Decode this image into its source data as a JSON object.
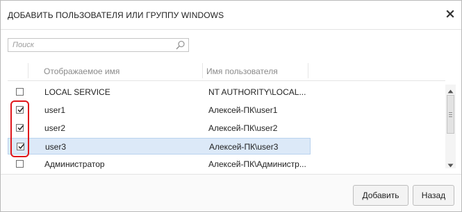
{
  "dialog": {
    "title": "ДОБАВИТЬ ПОЛЬЗОВАТЕЛЯ ИЛИ ГРУППУ WINDOWS",
    "close_icon": "close-icon"
  },
  "search": {
    "placeholder": "Поиск",
    "value": "",
    "icon": "search-icon"
  },
  "table": {
    "columns": [
      "Отображаемое имя",
      "Имя пользователя"
    ],
    "rows": [
      {
        "display_name": "LOCAL SERVICE",
        "user_name": "NT AUTHORITY\\LOCAL...",
        "checked": false,
        "selected": false
      },
      {
        "display_name": "user1",
        "user_name": "Алексей-ПК\\user1",
        "checked": true,
        "selected": false
      },
      {
        "display_name": "user2",
        "user_name": "Алексей-ПК\\user2",
        "checked": true,
        "selected": false
      },
      {
        "display_name": "user3",
        "user_name": "Алексей-ПК\\user3",
        "checked": true,
        "selected": true
      },
      {
        "display_name": "Администратор",
        "user_name": "Алексей-ПК\\Администр...",
        "checked": false,
        "selected": false
      }
    ]
  },
  "colors": {
    "selection": "#dce9f8",
    "annotation": "#e0161b"
  },
  "footer": {
    "add_label": "Добавить",
    "back_label": "Назад"
  }
}
